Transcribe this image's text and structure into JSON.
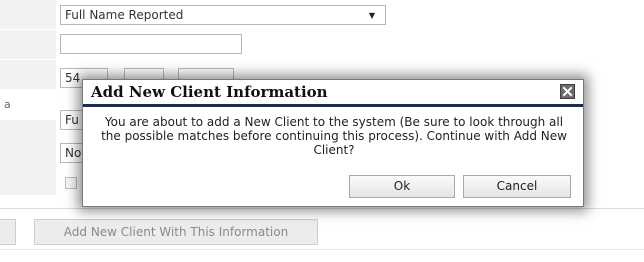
{
  "form": {
    "name_type_select": "Full Name Reported",
    "text_field": "",
    "ssn_part_1": "54",
    "row4_label_fragment": "a",
    "row4_select_fragment": "Fu",
    "row5_select_fragment": "No"
  },
  "bottom": {
    "add_client_button": "Add New Client With This Information"
  },
  "dialog": {
    "title": "Add New Client Information",
    "message": "You are about to add a New Client to the system (Be sure to look through all the possible matches before continuing this process). Continue with Add New Client?",
    "ok_label": "Ok",
    "cancel_label": "Cancel",
    "header_color": "#1c2b4a"
  }
}
